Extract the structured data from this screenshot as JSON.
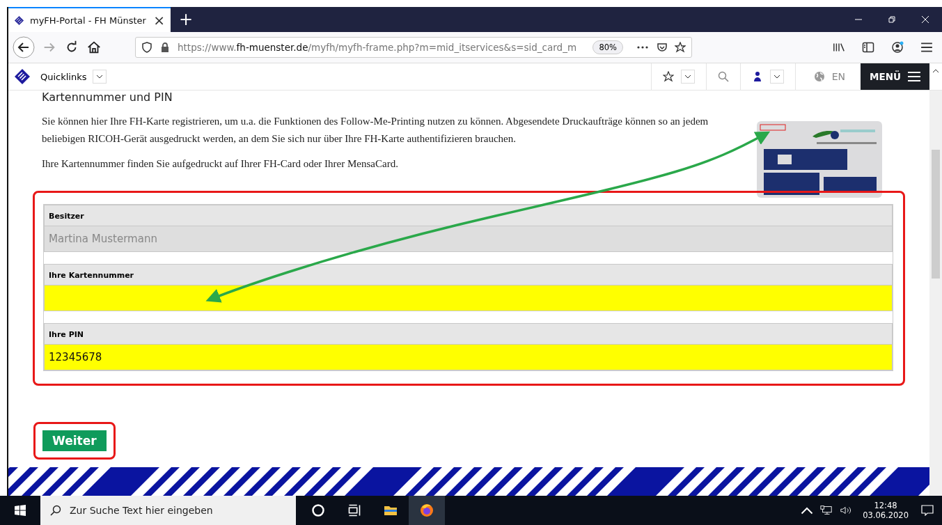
{
  "browser": {
    "tab": {
      "title": "myFH-Portal - FH Münster",
      "close": "×"
    },
    "new_tab": "+",
    "url": {
      "prefix": "https://www.",
      "domain": "fh-muenster.de",
      "path": "/myfh/myfh-frame.php?m=mid_itservices&s=sid_card_m"
    },
    "zoom": "80%"
  },
  "site_header": {
    "quicklinks": "Quicklinks",
    "language": "EN",
    "menu": "MENÜ"
  },
  "content": {
    "heading": "Kartennummer und PIN",
    "paragraphs": [
      "Sie können hier Ihre FH-Karte registrieren, um u.a. die Funktionen des Follow-Me-Printing nutzen zu können. Abgesendete Druckaufträge können so an jedem beliebigen RICOH-Gerät ausgedruckt werden, an dem Sie sich nur über Ihre FH-Karte authentifizieren brauchen.",
      "Ihre Kartennummer finden Sie aufgedruckt auf Ihrer FH-Card oder Ihrer MensaCard."
    ]
  },
  "form": {
    "fields": [
      {
        "label": "Besitzer",
        "value": "Martina Mustermann",
        "disabled": true,
        "highlighted": false
      },
      {
        "label": "Ihre Kartennummer",
        "disabled": false,
        "highlighted": true
      },
      {
        "label": "Ihre PIN",
        "value": "12345678",
        "disabled": false,
        "highlighted": true
      }
    ]
  },
  "submit": "Weiter",
  "taskbar": {
    "search_placeholder": "Zur Suche Text hier eingeben",
    "time": "12:48",
    "date": "03.06.2020"
  }
}
